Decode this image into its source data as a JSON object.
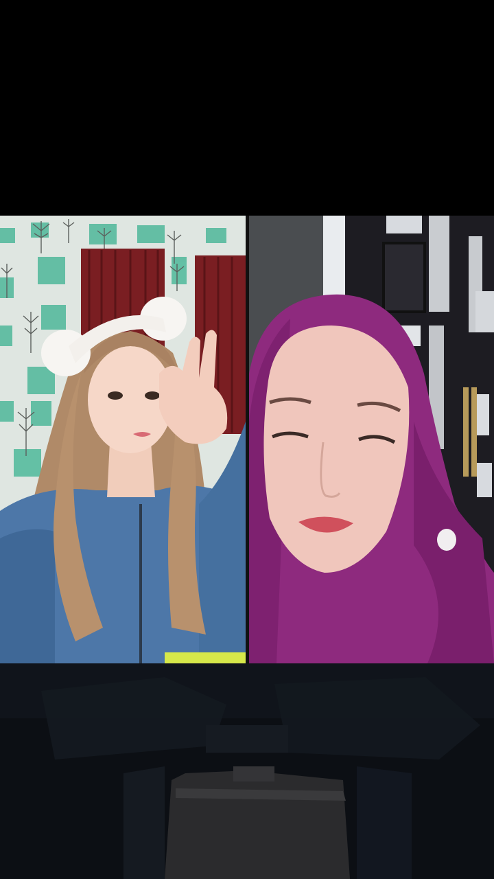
{
  "call": {
    "layout": "split-screen",
    "participants": [
      {
        "role": "left-video-feed",
        "scene": "participant-with-headband"
      },
      {
        "role": "right-video-feed",
        "scene": "participant-with-hijab"
      }
    ]
  },
  "colors": {
    "background": "#000000",
    "left_wall": "#dfe6e1",
    "left_tile": "#4fb89a",
    "curtain": "#7a1e22",
    "denim": "#4d77a8",
    "hair": "#b08a68",
    "hijab": "#8e2a7e",
    "door": "#1d1c22"
  }
}
